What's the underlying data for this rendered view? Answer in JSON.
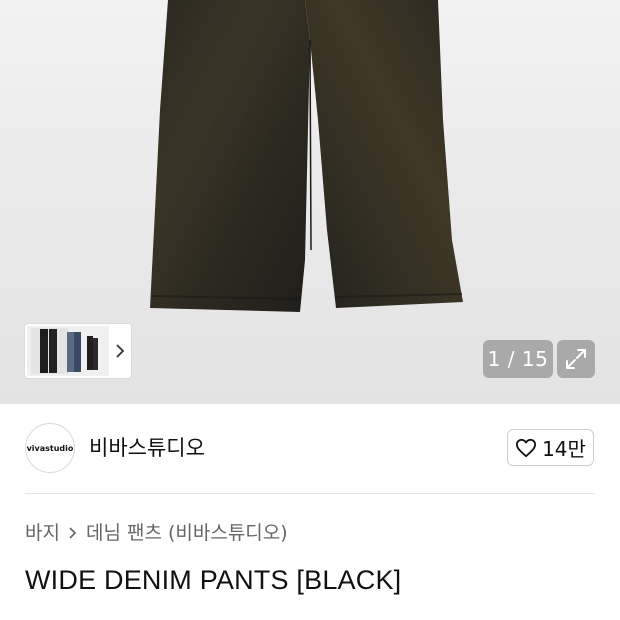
{
  "gallery": {
    "counter": "1 / 15",
    "thumbnail_alt": "product-thumbnails",
    "expand_icon": "expand-icon",
    "next_icon": "chevron-right-icon"
  },
  "brand": {
    "logo_text": "vivastudio",
    "name": "비바스튜디오",
    "like_count": "14만",
    "like_icon": "heart-icon"
  },
  "breadcrumb": {
    "items": [
      "바지",
      "데님 팬츠 (비바스튜디오)"
    ]
  },
  "product": {
    "title": "WIDE DENIM PANTS [BLACK]"
  },
  "colors": {
    "counter_bg": "#a9a9a9",
    "denim": "#2b2a22"
  }
}
